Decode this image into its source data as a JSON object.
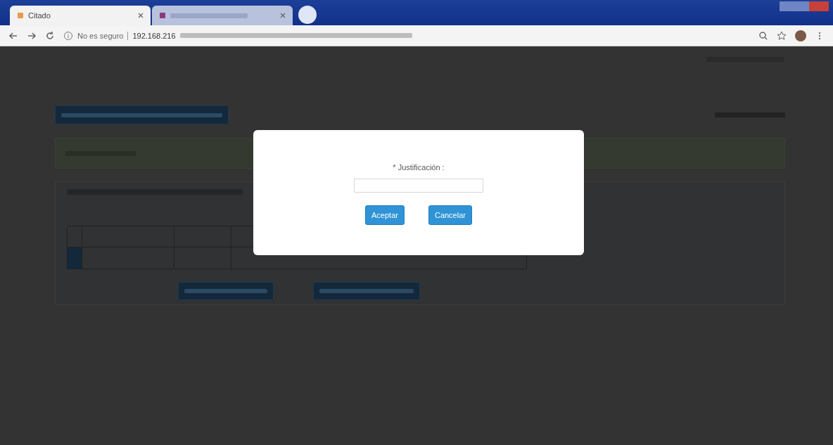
{
  "browser": {
    "tabs": [
      {
        "title": "Citado",
        "selected": true
      },
      {
        "selected": false
      }
    ],
    "security_label": "No es seguro",
    "address": "192.168.216"
  },
  "modal": {
    "field_label": "* Justificación :",
    "buttons": [
      {
        "label": "Aceptar",
        "kind": "primary"
      },
      {
        "label": "Cancelar",
        "kind": "primary"
      }
    ]
  }
}
